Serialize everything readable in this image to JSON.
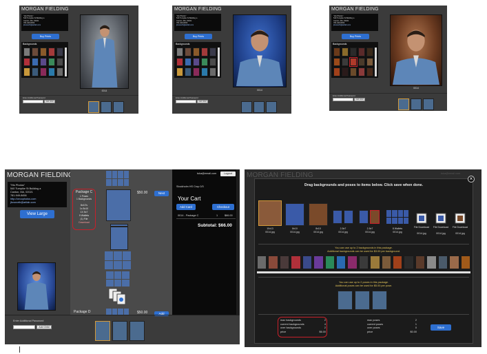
{
  "brand": "MORGAN FIELDING",
  "studio": {
    "name": "\"His Photos\"",
    "address1": "540 Turnpike St Building a",
    "address2": "Canton, MA, 02021",
    "phone": "781-949-8456",
    "website": "http://ceoophotos.com",
    "email": "jfoxworth@artlab.com"
  },
  "top_panels": {
    "buy_prints": "Buy Prints",
    "backgrounds_label": "Backgrounds",
    "photo_caption": "0014",
    "enter_password_label": "Enter Additional Password",
    "add_child": "Add Child"
  },
  "bottom_left": {
    "user_email": "tuka@email.com",
    "logout": "Logout",
    "view_large": "View Large",
    "package_c": {
      "title": "Package C",
      "line1": "1 Poses",
      "line2": "1 Backgrounds",
      "items": [
        "8x10's",
        "1x 8x10",
        "1X 5x7",
        "9 Wallets",
        "(1) File",
        "Download"
      ]
    },
    "price_c": "$50.00",
    "next": "Next",
    "package_d": "Package D",
    "price_d": "$50.00",
    "add": "Add",
    "school_line": "Stockholm HS Crop 0/3",
    "cart_title": "Your Cart",
    "add_card": "Add Card",
    "checkout": "Checkout",
    "cart_row": {
      "item": "0014 - Package C",
      "qty": "1",
      "price": "$66.00"
    },
    "subtotal": "Subtotal: $66.00",
    "enter_password": "Enter Additional Password",
    "add_child": "Add Child"
  },
  "modal": {
    "instruction": "Drag backgrounds and poses to items below. Click save when done.",
    "items": [
      {
        "size": "10x13",
        "file": "0014.jpg"
      },
      {
        "size": "8x10",
        "file": "0014.jpg"
      },
      {
        "size": "8x10",
        "file": "0014.jpg"
      },
      {
        "size": "2-5x7",
        "file": "0014.jpg"
      },
      {
        "size": "2-5x7",
        "file": "0014.jpg"
      },
      {
        "size": "8 Wallets",
        "file": "0014.jpg"
      },
      {
        "size": "File Download",
        "file": "0014.jpg"
      },
      {
        "size": "File Download",
        "file": "0014.jpg"
      },
      {
        "size": "File Download",
        "file": "0014.jpg"
      }
    ],
    "bg_note1": "You can use up to 2 backgrounds in this package.",
    "bg_note2": "Additional backgrounds can be used for $3.00 per background.",
    "pose_note1": "You can use up to 2 poses in this package.",
    "pose_note2": "Additional poses can be used for $5.00 per pose.",
    "stats_left": [
      {
        "label": "max backgrounds",
        "value": "2"
      },
      {
        "label": "current backgrounds",
        "value": "4"
      },
      {
        "label": "over backgrounds",
        "value": "2"
      },
      {
        "label": "price",
        "value": "$6.00"
      }
    ],
    "stats_right": [
      {
        "label": "max poses",
        "value": "2"
      },
      {
        "label": "current poses",
        "value": "1"
      },
      {
        "label": "over poses",
        "value": "0"
      },
      {
        "label": "price",
        "value": "$0.00"
      }
    ],
    "save": "Save",
    "close": "×"
  },
  "colors": {
    "accent_blue": "#2e6fd0",
    "highlight_red": "#c8202a",
    "selected_border": "#d59b3a"
  }
}
